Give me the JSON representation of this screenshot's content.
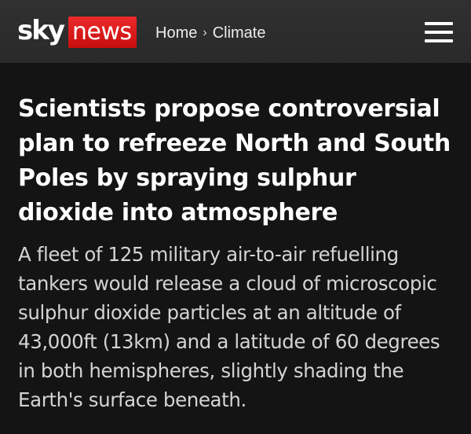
{
  "header": {
    "logo": {
      "sky": "sky",
      "news": "news",
      "news_bg_color": "#d71313"
    },
    "breadcrumb": [
      {
        "label": "Home"
      },
      {
        "label": "Climate"
      }
    ],
    "breadcrumb_separator": "›",
    "menu_icon": "hamburger-menu-icon"
  },
  "article": {
    "headline": "Scientists propose controversial plan to refreeze North and South Poles by spraying sulphur dioxide into atmosphere",
    "standfirst": "A fleet of 125 military air-to-air refuelling tankers would release a cloud of microscopic sulphur dioxide particles at an altitude of 43,000ft (13km) and a latitude of 60 degrees in both hemispheres, slightly shading the Earth's surface beneath."
  },
  "colors": {
    "page_background": "#141414",
    "header_background": "#2d2d2d",
    "headline_text": "#ffffff",
    "standfirst_text": "#d4d4d4"
  }
}
